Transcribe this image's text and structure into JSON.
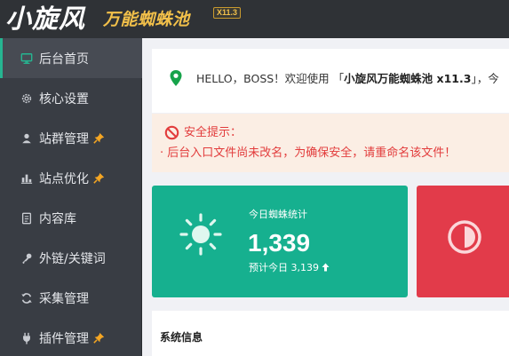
{
  "header": {
    "logo_script": "小旋风",
    "logo_subtitle": "万能蜘蛛池",
    "version_badge": "X11.3"
  },
  "sidebar": {
    "items": [
      {
        "label": "后台首页",
        "icon": "monitor-icon",
        "active": true
      },
      {
        "label": "核心设置",
        "icon": "gear-icon",
        "active": false
      },
      {
        "label": "站群管理",
        "icon": "user-icon",
        "pinned": true,
        "active": false
      },
      {
        "label": "站点优化",
        "icon": "bar-chart-icon",
        "pinned": true,
        "active": false
      },
      {
        "label": "内容库",
        "icon": "document-icon",
        "active": false
      },
      {
        "label": "外链/关键词",
        "icon": "key-icon",
        "active": false
      },
      {
        "label": "采集管理",
        "icon": "refresh-icon",
        "active": false
      },
      {
        "label": "插件管理",
        "icon": "plug-icon",
        "pinned": true,
        "active": false
      }
    ],
    "accent_color": "#26b591",
    "pin_color": "#f5a623"
  },
  "greeting": {
    "prefix": "HELLO，BOSS！欢迎使用 「",
    "product": "小旋风万能蜘蛛池 x11.3",
    "suffix": "」，今",
    "icon": "location-pin-icon",
    "icon_color": "#16a34a"
  },
  "warning": {
    "title": "安全提示：",
    "message": "· 后台入口文件尚未改名，为确保安全，请重命名该文件！",
    "icon": "ban-icon",
    "color": "#e23c3c"
  },
  "spider_stats": {
    "label": "今日蜘蛛统计",
    "value": "1,339",
    "forecast": "预计今日 3,139",
    "trend_icon": "arrow-up-icon",
    "card_color": "#16b08f"
  },
  "second_card": {
    "icon": "contrast-icon",
    "card_color": "#e23b4a"
  },
  "system_info": {
    "title": "系统信息"
  }
}
